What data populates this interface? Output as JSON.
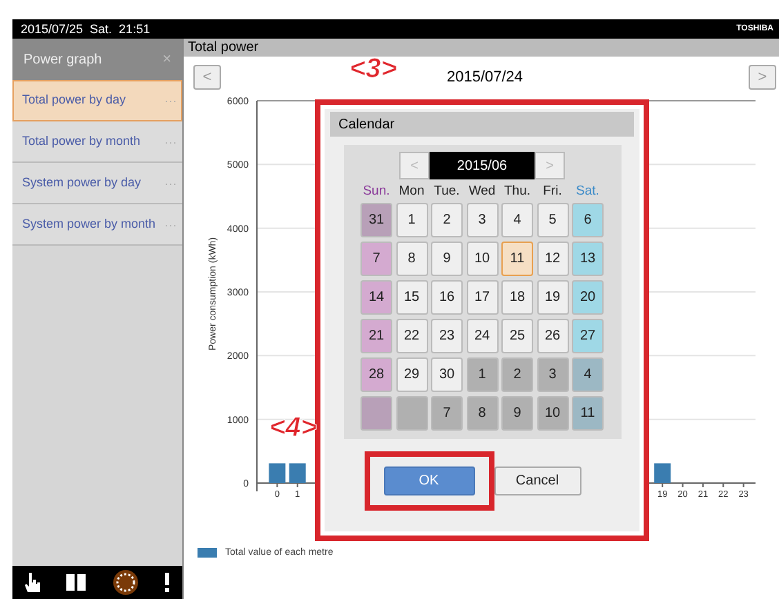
{
  "top_bar": {
    "datetime": "2015/07/25  Sat.  21:51",
    "brand": "TOSHIBA"
  },
  "sidebar": {
    "title": "Power graph",
    "close": "×",
    "items": [
      {
        "label": "Total power by day",
        "more": "···",
        "selected": true
      },
      {
        "label": "Total power by month",
        "more": "···",
        "selected": false
      },
      {
        "label": "System power by day",
        "more": "···",
        "selected": false
      },
      {
        "label": "System power by month",
        "more": "···",
        "selected": false
      }
    ]
  },
  "main": {
    "title": "Total power",
    "prev": "<",
    "date": "2015/07/24",
    "next": ">",
    "chart_data": {
      "type": "bar",
      "ylabel": "Power consumption (kWh)",
      "x": [
        0,
        1,
        2,
        3,
        4,
        5,
        6,
        7,
        8,
        9,
        10,
        11,
        12,
        13,
        14,
        15,
        16,
        17,
        18,
        19,
        20,
        21,
        22,
        23
      ],
      "series": [
        {
          "name": "Total value of each metre",
          "color": "#3a7db0",
          "values": [
            310,
            310,
            null,
            null,
            null,
            null,
            null,
            null,
            null,
            null,
            null,
            null,
            null,
            null,
            null,
            null,
            null,
            null,
            null,
            310,
            0,
            0,
            0,
            0
          ]
        }
      ],
      "xlim": [
        -1,
        24
      ],
      "ylim": [
        0,
        6000
      ],
      "yticks": [
        0,
        1000,
        2000,
        3000,
        4000,
        5000,
        6000
      ],
      "xticks": [
        0,
        1,
        19,
        20,
        21,
        22,
        23
      ],
      "grid": true
    }
  },
  "callouts": [
    {
      "label": "<3>"
    },
    {
      "label": "<4>"
    }
  ],
  "calendar": {
    "title": "Calendar",
    "prev": "<",
    "month": "2015/06",
    "next": ">",
    "weekdays": [
      {
        "label": "Sun.",
        "kind": "sun"
      },
      {
        "label": "Mon",
        "kind": "weekday"
      },
      {
        "label": "Tue.",
        "kind": "weekday"
      },
      {
        "label": "Wed",
        "kind": "weekday"
      },
      {
        "label": "Thu.",
        "kind": "weekday"
      },
      {
        "label": "Fri.",
        "kind": "weekday"
      },
      {
        "label": "Sat.",
        "kind": "sat"
      }
    ],
    "days": [
      {
        "label": "31",
        "kind": "sun",
        "outside": true,
        "selected": false
      },
      {
        "label": "1",
        "kind": "weekday",
        "outside": false,
        "selected": false
      },
      {
        "label": "2",
        "kind": "weekday",
        "outside": false,
        "selected": false
      },
      {
        "label": "3",
        "kind": "weekday",
        "outside": false,
        "selected": false
      },
      {
        "label": "4",
        "kind": "weekday",
        "outside": false,
        "selected": false
      },
      {
        "label": "5",
        "kind": "weekday",
        "outside": false,
        "selected": false
      },
      {
        "label": "6",
        "kind": "sat",
        "outside": false,
        "selected": false
      },
      {
        "label": "7",
        "kind": "sun",
        "outside": false,
        "selected": false
      },
      {
        "label": "8",
        "kind": "weekday",
        "outside": false,
        "selected": false
      },
      {
        "label": "9",
        "kind": "weekday",
        "outside": false,
        "selected": false
      },
      {
        "label": "10",
        "kind": "weekday",
        "outside": false,
        "selected": false
      },
      {
        "label": "11",
        "kind": "weekday",
        "outside": false,
        "selected": true
      },
      {
        "label": "12",
        "kind": "weekday",
        "outside": false,
        "selected": false
      },
      {
        "label": "13",
        "kind": "sat",
        "outside": false,
        "selected": false
      },
      {
        "label": "14",
        "kind": "sun",
        "outside": false,
        "selected": false
      },
      {
        "label": "15",
        "kind": "weekday",
        "outside": false,
        "selected": false
      },
      {
        "label": "16",
        "kind": "weekday",
        "outside": false,
        "selected": false
      },
      {
        "label": "17",
        "kind": "weekday",
        "outside": false,
        "selected": false
      },
      {
        "label": "18",
        "kind": "weekday",
        "outside": false,
        "selected": false
      },
      {
        "label": "19",
        "kind": "weekday",
        "outside": false,
        "selected": false
      },
      {
        "label": "20",
        "kind": "sat",
        "outside": false,
        "selected": false
      },
      {
        "label": "21",
        "kind": "sun",
        "outside": false,
        "selected": false
      },
      {
        "label": "22",
        "kind": "weekday",
        "outside": false,
        "selected": false
      },
      {
        "label": "23",
        "kind": "weekday",
        "outside": false,
        "selected": false
      },
      {
        "label": "24",
        "kind": "weekday",
        "outside": false,
        "selected": false
      },
      {
        "label": "25",
        "kind": "weekday",
        "outside": false,
        "selected": false
      },
      {
        "label": "26",
        "kind": "weekday",
        "outside": false,
        "selected": false
      },
      {
        "label": "27",
        "kind": "sat",
        "outside": false,
        "selected": false
      },
      {
        "label": "28",
        "kind": "sun",
        "outside": false,
        "selected": false
      },
      {
        "label": "29",
        "kind": "weekday",
        "outside": false,
        "selected": false
      },
      {
        "label": "30",
        "kind": "weekday",
        "outside": false,
        "selected": false
      },
      {
        "label": "1",
        "kind": "weekday",
        "outside": true,
        "selected": false
      },
      {
        "label": "2",
        "kind": "weekday",
        "outside": true,
        "selected": false
      },
      {
        "label": "3",
        "kind": "weekday",
        "outside": true,
        "selected": false
      },
      {
        "label": "4",
        "kind": "sat",
        "outside": true,
        "selected": false
      },
      {
        "kind": "sun",
        "outside": true,
        "selected": false
      },
      {
        "kind": "weekday",
        "outside": true,
        "selected": false
      },
      {
        "label": "7",
        "kind": "weekday",
        "outside": true,
        "selected": false
      },
      {
        "label": "8",
        "kind": "weekday",
        "outside": true,
        "selected": false
      },
      {
        "label": "9",
        "kind": "weekday",
        "outside": true,
        "selected": false
      },
      {
        "label": "10",
        "kind": "weekday",
        "outside": true,
        "selected": false
      },
      {
        "label": "11",
        "kind": "sat",
        "outside": true,
        "selected": false
      }
    ],
    "buttons": [
      {
        "label": "OK",
        "kind": "primary"
      },
      {
        "label": "Cancel",
        "kind": "secondary"
      }
    ]
  }
}
